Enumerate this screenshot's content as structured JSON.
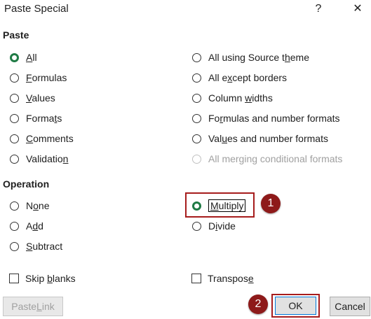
{
  "window": {
    "title": "Paste Special",
    "help_glyph": "?",
    "close_glyph": "✕"
  },
  "paste": {
    "heading": "Paste",
    "left": [
      {
        "pre": "",
        "u": "A",
        "post": "ll",
        "checked": true
      },
      {
        "pre": "",
        "u": "F",
        "post": "ormulas"
      },
      {
        "pre": "",
        "u": "V",
        "post": "alues"
      },
      {
        "pre": "Forma",
        "u": "t",
        "post": "s"
      },
      {
        "pre": "",
        "u": "C",
        "post": "omments"
      },
      {
        "pre": "Validatio",
        "u": "n",
        "post": ""
      }
    ],
    "right": [
      {
        "pre": "All using Source t",
        "u": "h",
        "post": "eme"
      },
      {
        "pre": "All e",
        "u": "x",
        "post": "cept borders"
      },
      {
        "pre": "Column ",
        "u": "w",
        "post": "idths"
      },
      {
        "pre": "Fo",
        "u": "r",
        "post": "mulas and number formats"
      },
      {
        "pre": "Val",
        "u": "u",
        "post": "es and number formats"
      },
      {
        "pre": "All merging conditional formats",
        "u": "",
        "post": "",
        "disabled": true
      }
    ]
  },
  "operation": {
    "heading": "Operation",
    "left": [
      {
        "pre": "N",
        "u": "o",
        "post": "ne"
      },
      {
        "pre": "A",
        "u": "d",
        "post": "d"
      },
      {
        "pre": "",
        "u": "S",
        "post": "ubtract"
      }
    ],
    "multiply": {
      "pre": "",
      "u": "M",
      "post": "ultiply",
      "checked": true
    },
    "divide": {
      "pre": "D",
      "u": "i",
      "post": "vide"
    }
  },
  "checkboxes": {
    "skip_blanks": {
      "pre": "Skip ",
      "u": "b",
      "post": "lanks"
    },
    "transpose": {
      "pre": "Transpos",
      "u": "e",
      "post": ""
    }
  },
  "buttons": {
    "paste_link": {
      "pre": "Paste ",
      "u": "L",
      "post": "ink"
    },
    "ok": "OK",
    "cancel": "Cancel"
  },
  "annotations": {
    "badge1": "1",
    "badge2": "2",
    "accent": "#a61c1c"
  }
}
